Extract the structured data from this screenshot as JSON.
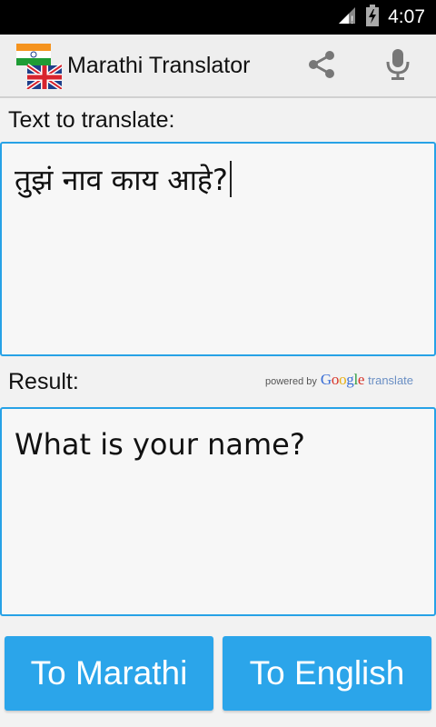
{
  "status_bar": {
    "time": "4:07"
  },
  "app_bar": {
    "title": "Marathi Translator",
    "icons": [
      "flag-logo-icon",
      "share-icon",
      "microphone-icon"
    ]
  },
  "input": {
    "label": "Text to translate:",
    "value": "तुझं नाव काय आहे?"
  },
  "result": {
    "label": "Result:",
    "value": "What is your name?",
    "powered_by": {
      "prefix": "powered by",
      "letters": [
        "G",
        "o",
        "o",
        "g",
        "l",
        "e"
      ],
      "suffix": "translate"
    }
  },
  "buttons": {
    "to_marathi": "To Marathi",
    "to_english": "To English"
  },
  "colors": {
    "accent": "#2ba5ea",
    "border": "#27a2e6",
    "appbar": "#eeeeee",
    "statusbar": "#000000"
  }
}
